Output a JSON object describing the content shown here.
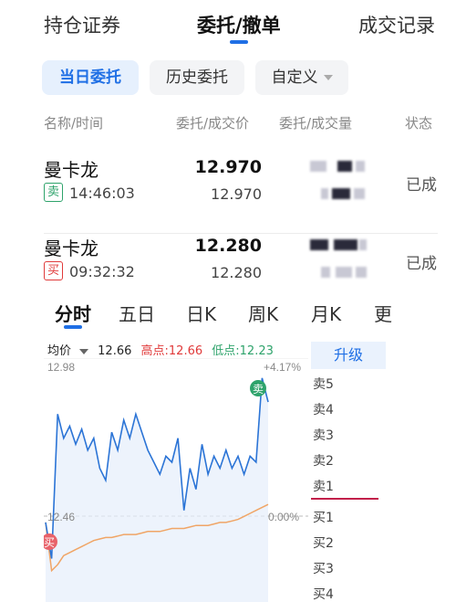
{
  "top_tabs": [
    {
      "label": "持仓证券"
    },
    {
      "label": "委托/撤单"
    },
    {
      "label": "成交记录"
    }
  ],
  "filters": [
    {
      "label": "当日委托"
    },
    {
      "label": "历史委托"
    },
    {
      "label": "自定义"
    }
  ],
  "columns": [
    "名称/时间",
    "委托/成交价",
    "委托/成交量",
    "状态"
  ],
  "orders": [
    {
      "name": "曼卡龙",
      "side": "卖",
      "time": "14:46:03",
      "order_price": "12.970",
      "deal_price": "12.970",
      "status": "已成"
    },
    {
      "name": "曼卡龙",
      "side": "买",
      "time": "09:32:32",
      "order_price": "12.280",
      "deal_price": "12.280",
      "status": "已成"
    }
  ],
  "chart_tabs": [
    {
      "label": "分时"
    },
    {
      "label": "五日"
    },
    {
      "label": "日K"
    },
    {
      "label": "周K"
    },
    {
      "label": "月K"
    },
    {
      "label": "更"
    }
  ],
  "chart_info": {
    "avg_label": "均价",
    "price": "12.66",
    "high": "高点:12.66",
    "low": "低点:12.23"
  },
  "chart_labels": {
    "y_top": "12.98",
    "y_mid": "12.46",
    "pct_top": "+4.17%",
    "pct_mid": "0.00%",
    "marker_sell": "卖",
    "marker_buy": "买"
  },
  "book": {
    "upgrade_label": "升级",
    "sell_levels": [
      "卖5",
      "卖4",
      "卖3",
      "卖2",
      "卖1"
    ],
    "buy_levels": [
      "买1",
      "买2",
      "买3",
      "买4"
    ]
  },
  "colors": {
    "accent": "#1f6fe5",
    "price_line": "#2b74d6",
    "avg_line": "#f0a566",
    "sell_green": "#2ea36b",
    "buy_red": "#e03a3a"
  },
  "chart_data": {
    "type": "line",
    "title": "",
    "ylim": [
      12.2,
      12.98
    ],
    "reference_price": 12.46,
    "series": [
      {
        "name": "均价",
        "values": [
          12.44,
          12.28,
          12.3,
          12.33,
          12.34,
          12.35,
          12.36,
          12.37,
          12.38,
          12.385,
          12.39,
          12.39,
          12.395,
          12.4,
          12.4,
          12.4,
          12.405,
          12.41,
          12.41,
          12.41,
          12.415,
          12.42,
          12.42,
          12.42,
          12.425,
          12.43,
          12.43,
          12.43,
          12.435,
          12.44,
          12.44,
          12.445,
          12.45,
          12.46,
          12.47,
          12.48,
          12.49,
          12.5
        ]
      },
      {
        "name": "",
        "values": [
          12.44,
          12.32,
          12.8,
          12.72,
          12.76,
          12.7,
          12.75,
          12.68,
          12.72,
          12.62,
          12.58,
          12.74,
          12.68,
          12.78,
          12.72,
          12.8,
          12.74,
          12.68,
          12.64,
          12.6,
          12.66,
          12.64,
          12.72,
          12.48,
          12.62,
          12.55,
          12.7,
          12.6,
          12.66,
          12.62,
          12.68,
          12.62,
          12.66,
          12.6,
          12.66,
          12.64,
          12.92,
          12.84
        ]
      }
    ]
  }
}
